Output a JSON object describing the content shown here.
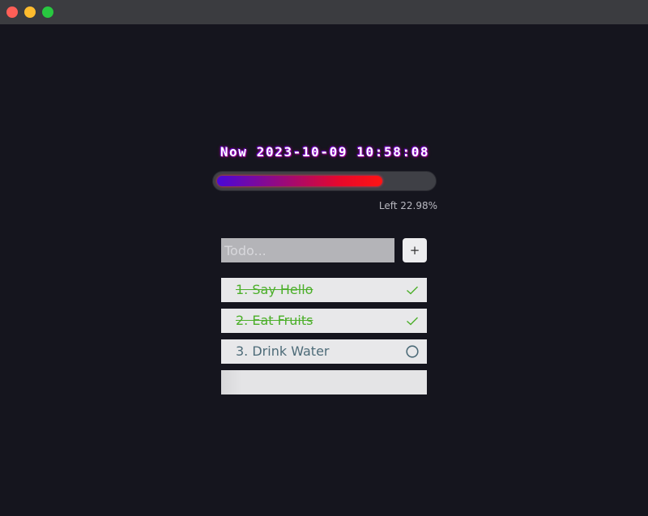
{
  "window": {
    "controls": [
      "close",
      "minimize",
      "maximize"
    ]
  },
  "clock": {
    "text": "Now 2023-10-09 10:58:08"
  },
  "progress": {
    "filled_fraction": 0.7702,
    "left_label": "Left 22.98%"
  },
  "todo_form": {
    "placeholder": "Todo...",
    "value": "",
    "add_label": "+"
  },
  "todos": [
    {
      "label": "1. Say Hello",
      "done": true,
      "status_icon": "check-icon"
    },
    {
      "label": "2. Eat Fruits",
      "done": true,
      "status_icon": "check-icon"
    },
    {
      "label": "3. Drink Water",
      "done": false,
      "status_icon": "circle-icon"
    },
    {
      "label": "",
      "done": false,
      "status_icon": ""
    }
  ],
  "colors": {
    "background": "#15151e",
    "done_text": "#4caf2a",
    "pending_text": "#4d6b78",
    "progress_start": "#4a08d6",
    "progress_end": "#ff1414"
  }
}
